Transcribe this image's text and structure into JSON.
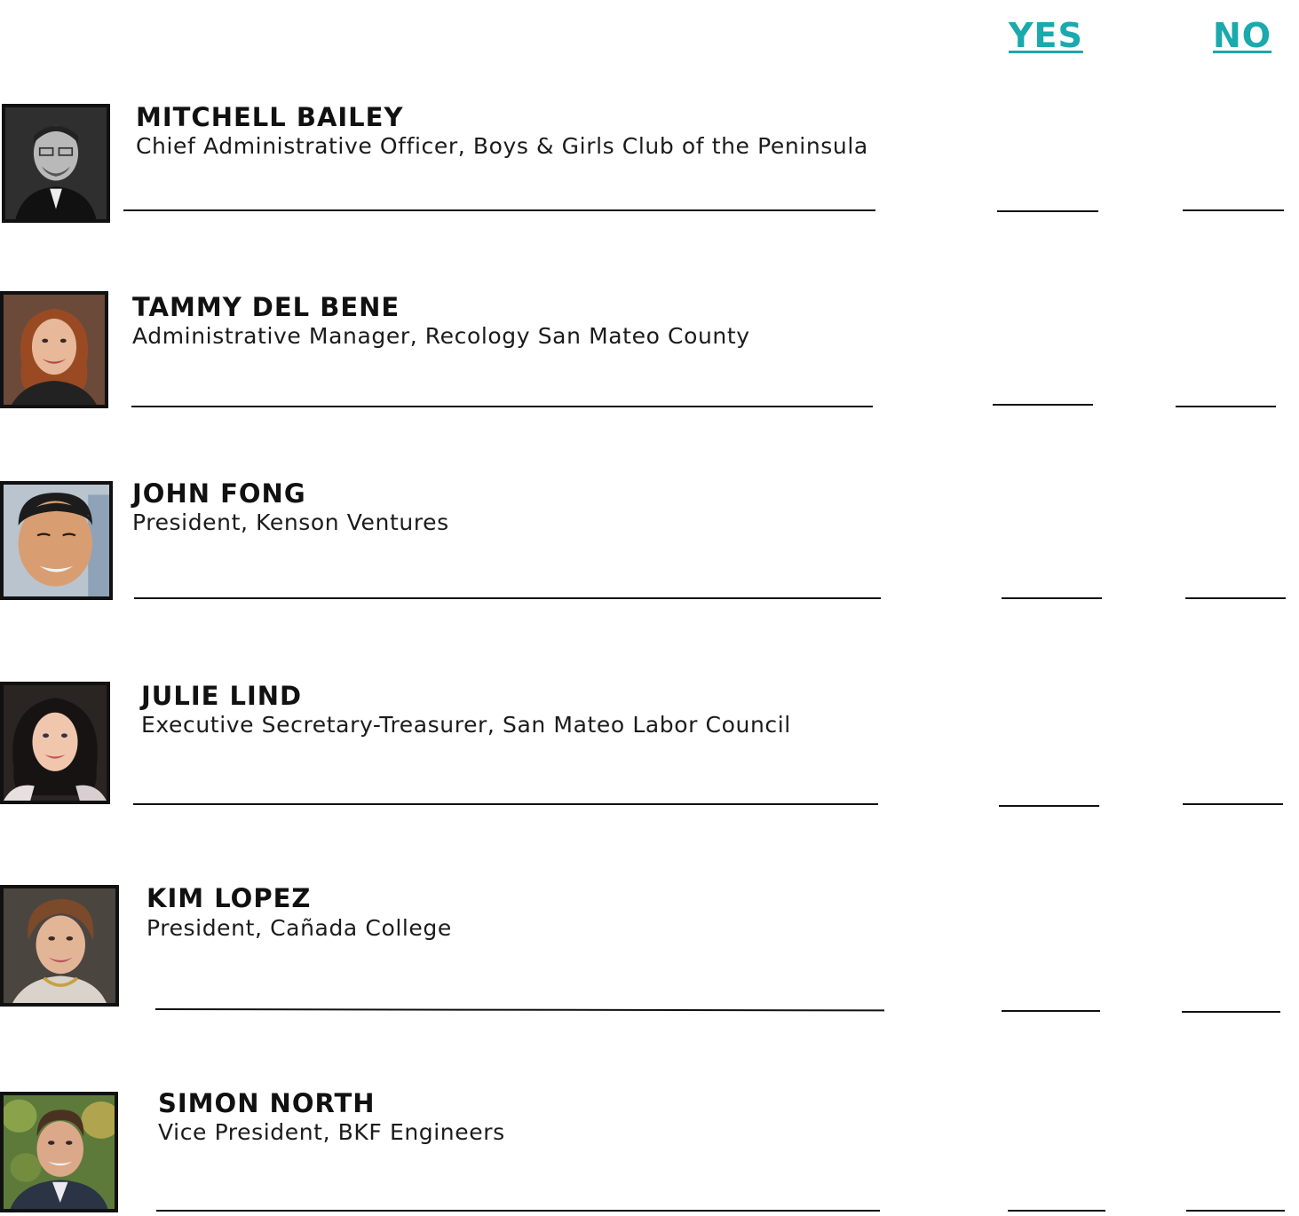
{
  "header": {
    "yes_label": "YES",
    "no_label": "NO",
    "accent_color": "#1aa9ad"
  },
  "candidates": [
    {
      "name": "MITCHELL BAILEY",
      "title": "Chief Administrative Officer, Boys & Girls Club of the Peninsula",
      "photo": "portrait-grayscale"
    },
    {
      "name": "TAMMY DEL BENE",
      "title": "Administrative Manager, Recology San Mateo County",
      "photo": "portrait"
    },
    {
      "name": "JOHN FONG",
      "title": "President, Kenson Ventures",
      "photo": "portrait"
    },
    {
      "name": "JULIE LIND",
      "title": "Executive Secretary-Treasurer, San Mateo Labor Council",
      "photo": "portrait"
    },
    {
      "name": "KIM LOPEZ",
      "title": "President, Cañada College",
      "photo": "portrait"
    },
    {
      "name": "SIMON NORTH",
      "title": "Vice President, BKF Engineers",
      "photo": "portrait"
    }
  ]
}
